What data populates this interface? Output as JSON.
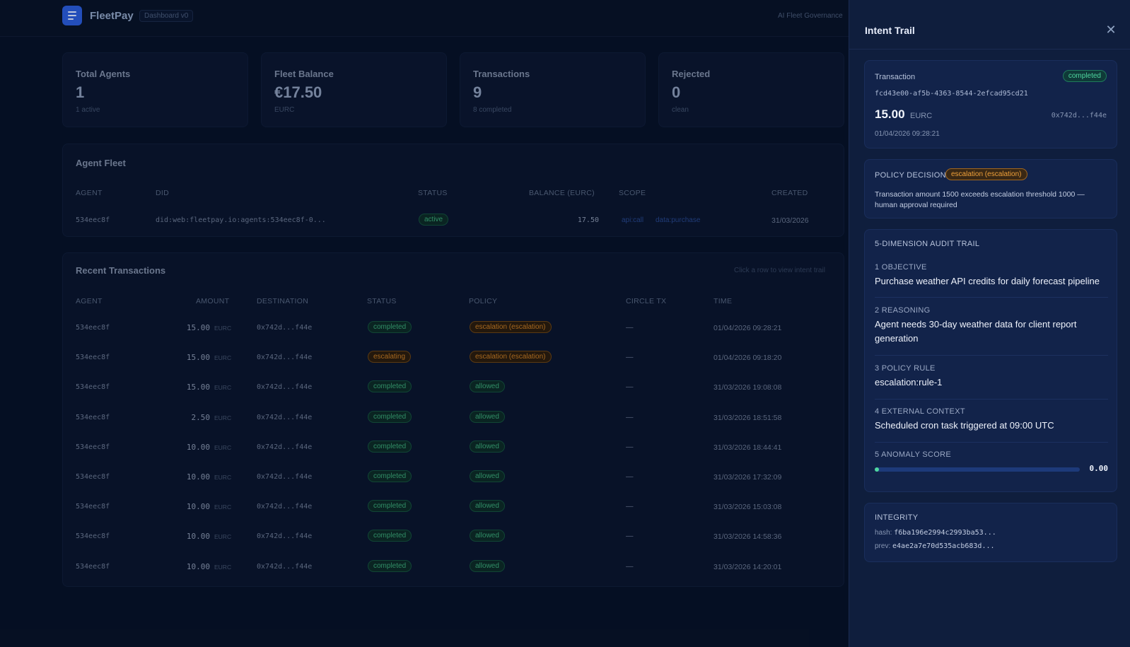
{
  "header": {
    "brand": "FleetPay",
    "version": "Dashboard v0",
    "tagline": "AI Fleet Governance"
  },
  "stats": [
    {
      "label": "Total Agents",
      "value": "1",
      "sub": "1 active"
    },
    {
      "label": "Fleet Balance",
      "value": "€17.50",
      "sub": "EURC"
    },
    {
      "label": "Transactions",
      "value": "9",
      "sub": "8 completed"
    },
    {
      "label": "Rejected",
      "value": "0",
      "sub": "clean"
    }
  ],
  "fleet": {
    "title": "Agent Fleet",
    "columns": [
      "AGENT",
      "DID",
      "STATUS",
      "BALANCE (EURC)",
      "SCOPE",
      "CREATED"
    ],
    "row": {
      "agent": "534eec8f",
      "did": "did:web:fleetpay.io:agents:534eec8f-0...",
      "status": "active",
      "balance": "17.50",
      "scope": [
        "api:call",
        "data:purchase"
      ],
      "created": "31/03/2026"
    }
  },
  "transactions": {
    "title": "Recent Transactions",
    "hint": "Click a row to view intent trail",
    "columns": [
      "AGENT",
      "AMOUNT",
      "DESTINATION",
      "STATUS",
      "POLICY",
      "CIRCLE TX",
      "TIME"
    ],
    "currency": "EURC",
    "rows": [
      {
        "agent": "534eec8f",
        "amount": "15.00",
        "dest": "0x742d...f44e",
        "status": "completed",
        "policy": "escalation (escalation)",
        "circle": "—",
        "time": "01/04/2026 09:28:21"
      },
      {
        "agent": "534eec8f",
        "amount": "15.00",
        "dest": "0x742d...f44e",
        "status": "escalating",
        "policy": "escalation (escalation)",
        "circle": "—",
        "time": "01/04/2026 09:18:20"
      },
      {
        "agent": "534eec8f",
        "amount": "15.00",
        "dest": "0x742d...f44e",
        "status": "completed",
        "policy": "allowed",
        "circle": "—",
        "time": "31/03/2026 19:08:08"
      },
      {
        "agent": "534eec8f",
        "amount": "2.50",
        "dest": "0x742d...f44e",
        "status": "completed",
        "policy": "allowed",
        "circle": "—",
        "time": "31/03/2026 18:51:58"
      },
      {
        "agent": "534eec8f",
        "amount": "10.00",
        "dest": "0x742d...f44e",
        "status": "completed",
        "policy": "allowed",
        "circle": "—",
        "time": "31/03/2026 18:44:41"
      },
      {
        "agent": "534eec8f",
        "amount": "10.00",
        "dest": "0x742d...f44e",
        "status": "completed",
        "policy": "allowed",
        "circle": "—",
        "time": "31/03/2026 17:32:09"
      },
      {
        "agent": "534eec8f",
        "amount": "10.00",
        "dest": "0x742d...f44e",
        "status": "completed",
        "policy": "allowed",
        "circle": "—",
        "time": "31/03/2026 15:03:08"
      },
      {
        "agent": "534eec8f",
        "amount": "10.00",
        "dest": "0x742d...f44e",
        "status": "completed",
        "policy": "allowed",
        "circle": "—",
        "time": "31/03/2026 14:58:36"
      },
      {
        "agent": "534eec8f",
        "amount": "10.00",
        "dest": "0x742d...f44e",
        "status": "completed",
        "policy": "allowed",
        "circle": "—",
        "time": "31/03/2026 14:20:01"
      }
    ]
  },
  "drawer": {
    "title": "Intent Trail",
    "tx": {
      "label": "Transaction",
      "status": "completed",
      "id": "fcd43e00-af5b-4363-8544-2efcad95cd21",
      "amount": "15.00",
      "currency": "EURC",
      "dest": "0x742d...f44e",
      "time": "01/04/2026 09:28:21"
    },
    "policy": {
      "label": "POLICY DECISION",
      "badge": "escalation (escalation)",
      "text": "Transaction amount 1500 exceeds escalation threshold 1000 — human approval required"
    },
    "audit": {
      "title": "5-DIMENSION AUDIT TRAIL",
      "items": [
        {
          "head": "1  OBJECTIVE",
          "body": "Purchase weather API credits for daily forecast pipeline"
        },
        {
          "head": "2  REASONING",
          "body": "Agent needs 30-day weather data for client report generation"
        },
        {
          "head": "3  POLICY RULE",
          "body": "escalation:rule-1"
        },
        {
          "head": "4  EXTERNAL CONTEXT",
          "body": "Scheduled cron task triggered at 09:00 UTC"
        }
      ],
      "anomaly_head": "5  ANOMALY SCORE",
      "anomaly_value": "0.00",
      "anomaly_fraction": 0.0
    },
    "integrity": {
      "title": "INTEGRITY",
      "hash_label": "hash:",
      "hash": "f6ba196e2994c2993ba53...",
      "prev_label": "prev:",
      "prev": "e4ae2a7e70d535acb683d..."
    }
  },
  "colors": {
    "bg": "#071126",
    "drawer": "#0f1e3d",
    "green": "#4fd8a0",
    "orange": "#f0a13a",
    "accent": "#2a5bd7"
  }
}
